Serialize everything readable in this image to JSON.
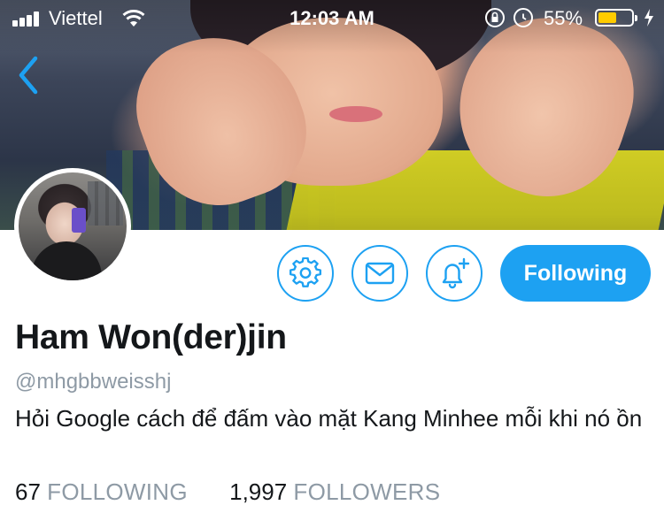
{
  "status_bar": {
    "carrier": "Viettel",
    "time": "12:03 AM",
    "battery_percent": "55%",
    "battery_level": 0.55,
    "battery_color": "#ffcc00",
    "icons": [
      "signal-icon",
      "wifi-icon",
      "orientation-lock-icon",
      "alarm-icon",
      "battery-icon",
      "charging-bolt-icon"
    ]
  },
  "navigation": {
    "back_icon": "chevron-left-icon"
  },
  "profile": {
    "display_name": "Ham Won(der)jin",
    "handle": "@mhgbbweisshj",
    "bio": "Hỏi Google cách để đấm vào mặt Kang Minhee mỗi khi nó ồn",
    "following_count": "67",
    "following_label": "FOLLOWING",
    "followers_count": "1,997",
    "followers_label": "FOLLOWERS"
  },
  "actions": {
    "settings_icon": "gear-icon",
    "message_icon": "envelope-icon",
    "notify_icon": "bell-plus-icon",
    "follow_button_label": "Following"
  },
  "colors": {
    "accent": "#1da1f2",
    "text_primary": "#14171a",
    "text_secondary": "#8e9aa5"
  }
}
